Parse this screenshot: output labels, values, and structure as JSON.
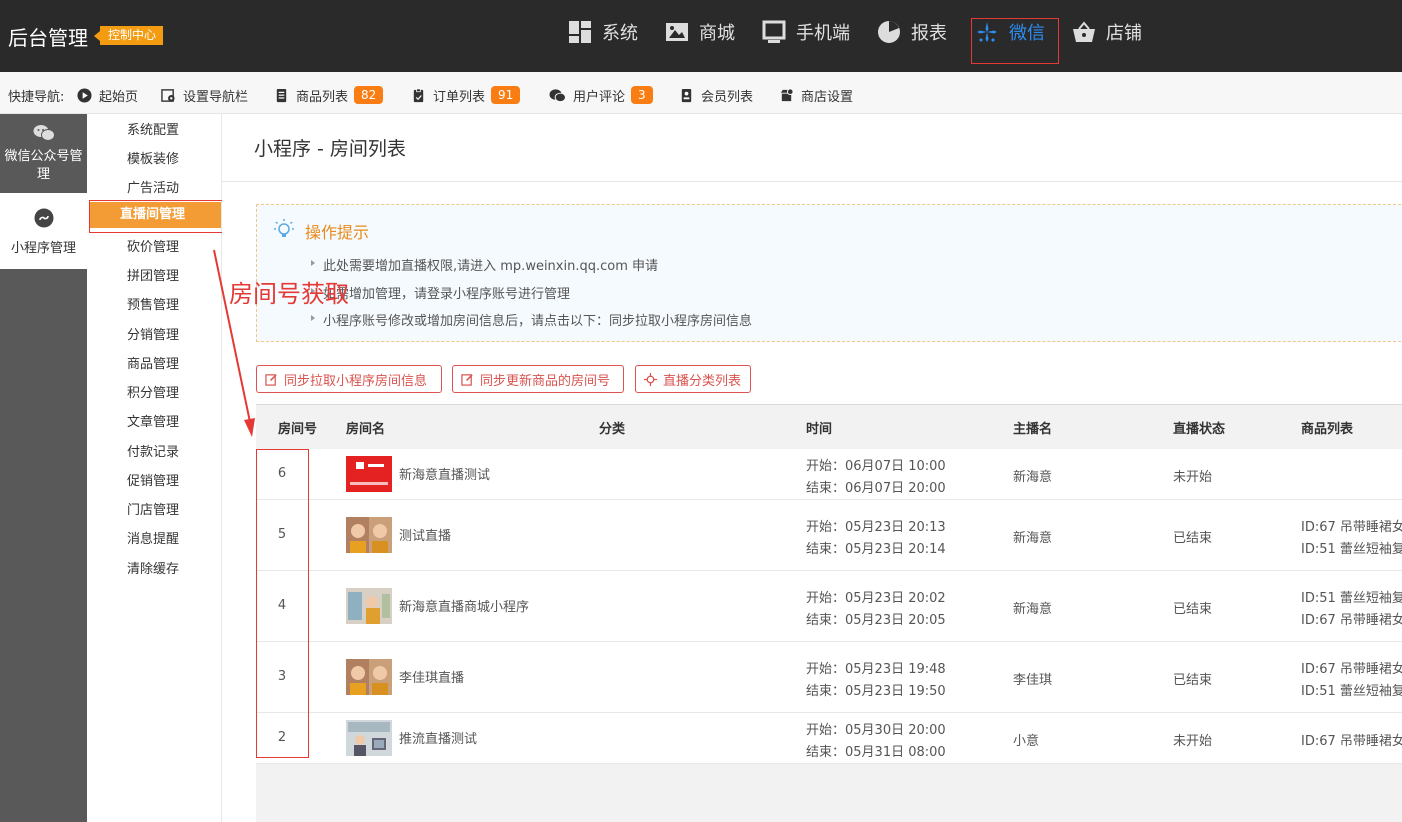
{
  "header": {
    "brand": "后台管理",
    "badge": "控制中心",
    "nav": [
      {
        "label": "系统",
        "icon": "dashboard-icon"
      },
      {
        "label": "商城",
        "icon": "image-icon"
      },
      {
        "label": "手机端",
        "icon": "monitor-icon"
      },
      {
        "label": "报表",
        "icon": "pie-chart-icon"
      },
      {
        "label": "微信",
        "icon": "wechat-sparkle-icon"
      },
      {
        "label": "店铺",
        "icon": "shopping-basket-icon"
      }
    ],
    "active": "微信"
  },
  "quicknav": {
    "label": "快捷导航:",
    "items": [
      {
        "label": "起始页",
        "icon": "play-circle-icon"
      },
      {
        "label": "设置导航栏",
        "icon": "settings-icon"
      },
      {
        "label": "商品列表",
        "icon": "document-icon",
        "count": "82"
      },
      {
        "label": "订单列表",
        "icon": "clipboard-icon",
        "count": "91"
      },
      {
        "label": "用户评论",
        "icon": "comments-icon",
        "count": "3"
      },
      {
        "label": "会员列表",
        "icon": "member-icon"
      },
      {
        "label": "商店设置",
        "icon": "shop-settings-icon"
      }
    ]
  },
  "sidebar_primary": {
    "items": [
      {
        "label": "微信公众号管理",
        "icon": "wechat-icon"
      },
      {
        "label": "小程序管理",
        "icon": "miniprogram-icon"
      }
    ]
  },
  "sidebar_secondary": {
    "items": [
      "系统配置",
      "模板装修",
      "广告活动",
      "直播间管理",
      "砍价管理",
      "拼团管理",
      "预售管理",
      "分销管理",
      "商品管理",
      "积分管理",
      "文章管理",
      "付款记录",
      "促销管理",
      "门店管理",
      "消息提醒",
      "清除缓存"
    ],
    "active": "直播间管理"
  },
  "page": {
    "title": "小程序 - 房间列表"
  },
  "tips": {
    "title": "操作提示",
    "lines": [
      "此处需要增加直播权限,请进入 mp.weinxin.qq.com 申请",
      "如需增加管理，请登录小程序账号进行管理",
      "小程序账号修改或增加房间信息后，请点击以下：同步拉取小程序房间信息"
    ]
  },
  "buttons": [
    {
      "label": "同步拉取小程序房间信息",
      "icon": "edit-icon"
    },
    {
      "label": "同步更新商品的房间号",
      "icon": "edit-icon"
    },
    {
      "label": "直播分类列表",
      "icon": "crosshair-icon"
    }
  ],
  "table": {
    "columns": [
      "房间号",
      "房间名",
      "分类",
      "时间",
      "主播名",
      "直播状态",
      "商品列表"
    ],
    "rows": [
      {
        "id": "6",
        "name": "新海意直播测试",
        "start": "开始：06月07日 10:00",
        "end": "结束：06月07日 20:00",
        "anchor": "新海意",
        "status": "未开始",
        "goods": []
      },
      {
        "id": "5",
        "name": "测试直播",
        "start": "开始：05月23日 20:13",
        "end": "结束：05月23日 20:14",
        "anchor": "新海意",
        "status": "已结束",
        "goods": [
          "ID:67  吊带睡裙女",
          "ID:51  蕾丝短袖复"
        ]
      },
      {
        "id": "4",
        "name": "新海意直播商城小程序",
        "start": "开始：05月23日 20:02",
        "end": "结束：05月23日 20:05",
        "anchor": "新海意",
        "status": "已结束",
        "goods": [
          "ID:51  蕾丝短袖复",
          "ID:67  吊带睡裙女"
        ]
      },
      {
        "id": "3",
        "name": "李佳琪直播",
        "start": "开始：05月23日 19:48",
        "end": "结束：05月23日 19:50",
        "anchor": "李佳琪",
        "status": "已结束",
        "goods": [
          "ID:67  吊带睡裙女",
          "ID:51  蕾丝短袖复"
        ]
      },
      {
        "id": "2",
        "name": "推流直播测试",
        "start": "开始：05月30日 20:00",
        "end": "结束：05月31日 08:00",
        "anchor": "小意",
        "status": "未开始",
        "goods": [
          "ID:67  吊带睡裙女"
        ]
      }
    ]
  },
  "annotation": {
    "text": "房间号获取"
  },
  "colors": {
    "header_bg": "#2a2a2a",
    "accent_orange": "#f39c12",
    "active_blue": "#2d8cf0",
    "highlight_red": "#e53935",
    "badge_orange": "#f97d12"
  }
}
